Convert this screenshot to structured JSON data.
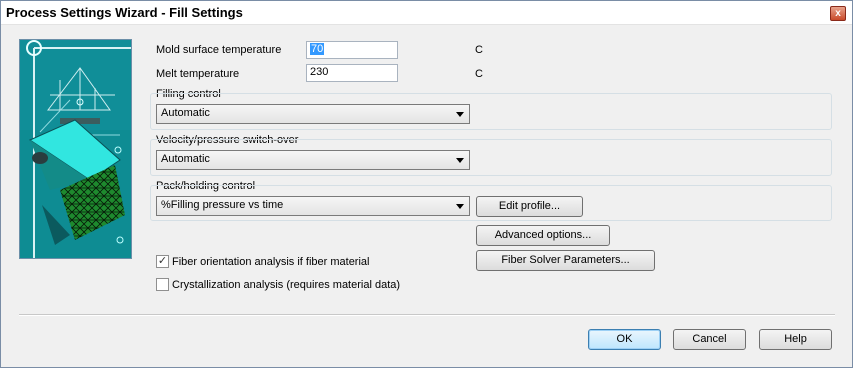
{
  "window": {
    "title": "Process Settings Wizard - Fill Settings",
    "close_glyph": "x"
  },
  "mold_temp": {
    "label": "Mold surface temperature",
    "value": "70",
    "unit": "C"
  },
  "melt_temp": {
    "label": "Melt temperature",
    "value": "230",
    "unit": "C"
  },
  "filling_control": {
    "label": "Filling control",
    "selected": "Automatic"
  },
  "switch_over": {
    "label": "Velocity/pressure switch-over",
    "selected": "Automatic"
  },
  "pack_control": {
    "label": "Pack/holding control",
    "selected": "%Filling pressure vs time",
    "edit_label": "Edit profile..."
  },
  "advanced_label": "Advanced options...",
  "fiber": {
    "label": "Fiber orientation analysis if fiber material",
    "checked": true,
    "check_glyph": "✓"
  },
  "fiber_solver_label": "Fiber Solver Parameters...",
  "crystallization": {
    "label": "Crystallization analysis (requires material data)",
    "checked": false
  },
  "buttons": {
    "ok": "OK",
    "cancel": "Cancel",
    "help": "Help"
  }
}
